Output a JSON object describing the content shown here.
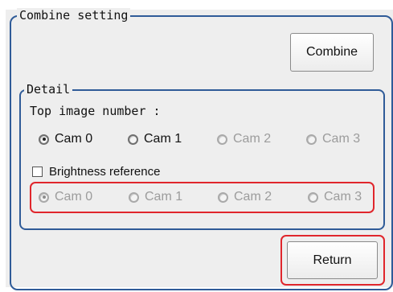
{
  "combine_setting": {
    "legend": "Combine setting",
    "combine_button": "Combine"
  },
  "detail": {
    "legend": "Detail",
    "top_image_label": "Top image number :",
    "top_image_options": [
      "Cam 0",
      "Cam 1",
      "Cam 2",
      "Cam 3"
    ],
    "top_image_selected": "Cam 0",
    "brightness_label": "Brightness reference",
    "brightness_checked": false,
    "brightness_options": [
      "Cam 0",
      "Cam 1",
      "Cam 2",
      "Cam 3"
    ],
    "brightness_selected": "Cam 0"
  },
  "footer": {
    "return_button": "Return"
  },
  "colors": {
    "frame": "#2f5b98",
    "highlight": "#e0262c"
  }
}
